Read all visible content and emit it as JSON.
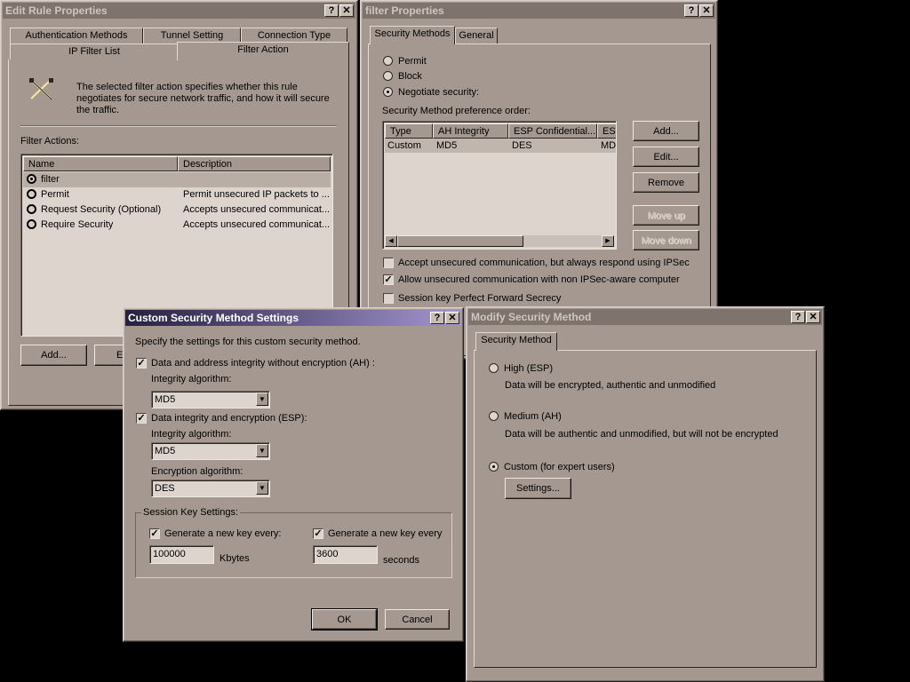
{
  "edit_rule": {
    "title": "Edit Rule Properties",
    "tabs_back": [
      "Authentication Methods",
      "Tunnel Setting",
      "Connection Type"
    ],
    "tabs_front": [
      "IP Filter List",
      "Filter Action"
    ],
    "description": "The selected filter action specifies whether this rule negotiates for secure network traffic, and how it will secure the traffic.",
    "filter_actions_label": "Filter Actions:",
    "columns": [
      "Name",
      "Description"
    ],
    "rows": [
      {
        "name": "filter",
        "description": ""
      },
      {
        "name": "Permit",
        "description": "Permit unsecured IP packets to ..."
      },
      {
        "name": "Request Security (Optional)",
        "description": "Accepts unsecured communicat..."
      },
      {
        "name": "Require Security",
        "description": "Accepts unsecured communicat..."
      }
    ],
    "add_button": "Add...",
    "edit_button_partial": "E"
  },
  "filter_props": {
    "title": "filter Properties",
    "tabs": [
      "Security Methods",
      "General"
    ],
    "options": [
      "Permit",
      "Block",
      "Negotiate security:"
    ],
    "pref_label": "Security Method preference order:",
    "columns": [
      "Type",
      "AH Integrity",
      "ESP Confidential...",
      "ES"
    ],
    "rows": [
      {
        "type": "Custom",
        "ah": "MD5",
        "esp": "DES",
        "es": "MD"
      }
    ],
    "buttons": [
      "Add...",
      "Edit...",
      "Remove",
      "Move up",
      "Move down"
    ],
    "checks": [
      {
        "label": "Accept unsecured communication, but always respond using IPSec",
        "checked": false
      },
      {
        "label": "Allow unsecured communication with non IPSec-aware computer",
        "checked": true
      },
      {
        "label": "Session key Perfect Forward Secrecy",
        "checked": false
      }
    ]
  },
  "custom": {
    "title": "Custom Security Method Settings",
    "intro": "Specify the settings for this custom security method.",
    "ah_label": "Data and address integrity without encryption (AH) :",
    "integrity_label": "Integrity algorithm:",
    "ah_integrity": "MD5",
    "esp_label": "Data integrity and encryption (ESP):",
    "esp_integrity_label": "Integrity algorithm:",
    "esp_integrity": "MD5",
    "encryption_label": "Encryption algorithm:",
    "encryption": "DES",
    "session_label": "Session Key Settings:",
    "gen_kbytes_label": "Generate a new key every:",
    "kbytes_value": "100000",
    "kbytes_unit": "Kbytes",
    "gen_seconds_label": "Generate a new key every",
    "seconds_value": "3600",
    "seconds_unit": "seconds",
    "ok": "OK",
    "cancel": "Cancel"
  },
  "modify": {
    "title": "Modify Security Method",
    "tab": "Security Method",
    "high_label": "High (ESP)",
    "high_desc": "Data will be encrypted, authentic and unmodified",
    "medium_label": "Medium (AH)",
    "medium_desc": "Data will be authentic and unmodified, but will not be encrypted",
    "custom_label": "Custom (for expert users)",
    "settings_button": "Settings..."
  },
  "titlebar_buttons": {
    "help": "?",
    "close": "✕"
  },
  "colors": {
    "dialog_face": "#a59890",
    "active_title_start": "#262040",
    "active_title_end": "#a396cf",
    "inactive_title": "#7f746d"
  }
}
